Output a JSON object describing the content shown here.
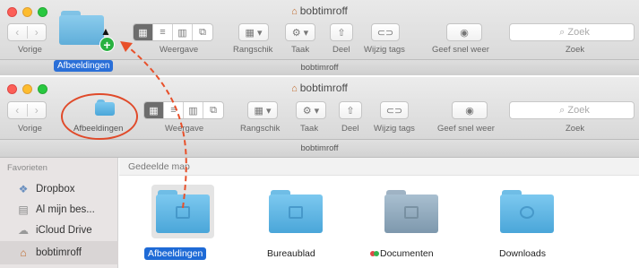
{
  "window_top": {
    "title": "bobtimroff",
    "path": "bobtimroff",
    "back_label": "Vorige",
    "view_label": "Weergave",
    "arrange_label": "Rangschik",
    "action_label": "Taak",
    "share_label": "Deel",
    "tags_label": "Wijzig tags",
    "quicklook_label": "Geef snel weer",
    "search_label": "Zoek",
    "search_placeholder": "Zoek",
    "drag_chip_label": "Afbeeldingen"
  },
  "window_bottom": {
    "title": "bobtimroff",
    "path": "bobtimroff",
    "back_label": "Vorige",
    "toolbar_folder_label": "Afbeeldingen",
    "view_label": "Weergave",
    "arrange_label": "Rangschik",
    "action_label": "Taak",
    "share_label": "Deel",
    "tags_label": "Wijzig tags",
    "quicklook_label": "Geef snel weer",
    "search_label": "Zoek",
    "search_placeholder": "Zoek"
  },
  "sidebar": {
    "heading": "Favorieten",
    "items": [
      {
        "label": "Dropbox",
        "icon": "dropbox-icon"
      },
      {
        "label": "Al mijn bes...",
        "icon": "all-files-icon"
      },
      {
        "label": "iCloud Drive",
        "icon": "cloud-icon"
      },
      {
        "label": "bobtimroff",
        "icon": "home-icon"
      }
    ]
  },
  "content": {
    "heading": "Gedeelde map",
    "folders": [
      {
        "label": "Afbeeldingen",
        "selected": true
      },
      {
        "label": "Bureaublad",
        "selected": false
      },
      {
        "label": "Documenten",
        "selected": false,
        "tags": [
          "#e04848",
          "#37b24d"
        ]
      },
      {
        "label": "Downloads",
        "selected": false
      }
    ]
  },
  "colors": {
    "selection": "#1e6ad6",
    "drag_arrow": "#e8502a",
    "highlight_circle": "#e04a2a",
    "folder_blue": "#5ab4e5"
  }
}
